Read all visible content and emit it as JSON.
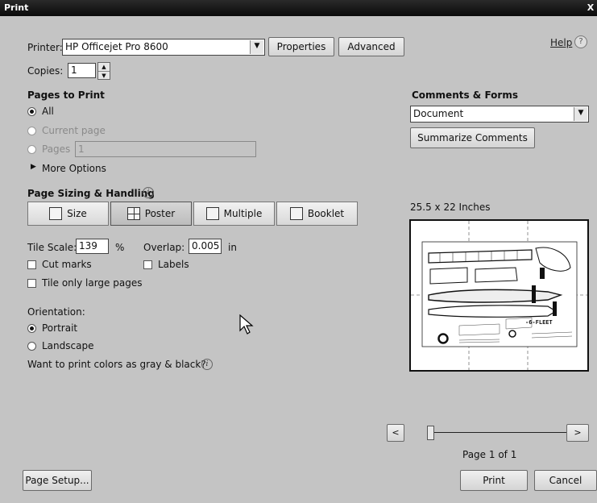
{
  "window": {
    "title": "Print",
    "close_glyph": "X"
  },
  "printer": {
    "label": "Printer:",
    "value": "HP Officejet Pro 8600",
    "properties_label": "Properties",
    "advanced_label": "Advanced"
  },
  "help": {
    "label": "Help"
  },
  "copies": {
    "label": "Copies:",
    "value": "1"
  },
  "pages_to_print": {
    "heading": "Pages to Print",
    "all_label": "All",
    "current_page_label": "Current page",
    "pages_label": "Pages",
    "pages_value": "1",
    "more_options_label": "More Options",
    "selected": "All"
  },
  "sizing": {
    "heading": "Page Sizing & Handling",
    "tabs": [
      {
        "label": "Size",
        "icon": "size-icon"
      },
      {
        "label": "Poster",
        "icon": "poster-icon"
      },
      {
        "label": "Multiple",
        "icon": "multiple-icon"
      },
      {
        "label": "Booklet",
        "icon": "booklet-icon"
      }
    ],
    "selected_tab": "Poster",
    "tile_scale_label": "Tile Scale:",
    "tile_scale_value": "139",
    "tile_scale_unit": "%",
    "overlap_label": "Overlap:",
    "overlap_value": "0.005",
    "overlap_unit": "in",
    "cut_marks_label": "Cut marks",
    "labels_label": "Labels",
    "tile_large_label": "Tile only large pages"
  },
  "orientation": {
    "label": "Orientation:",
    "portrait_label": "Portrait",
    "landscape_label": "Landscape",
    "selected": "Portrait",
    "gray_question": "Want to print colors as gray & black?"
  },
  "comments": {
    "heading": "Comments & Forms",
    "value": "Document",
    "summarize_label": "Summarize Comments"
  },
  "preview": {
    "size_label": "25.5 x 22 Inches",
    "fleet_text": "-6-FLEET",
    "prev_glyph": "<",
    "next_glyph": ">",
    "page_indicator": "Page 1 of 1",
    "slider_position": 0
  },
  "footer": {
    "page_setup_label": "Page Setup...",
    "print_label": "Print",
    "cancel_label": "Cancel"
  }
}
